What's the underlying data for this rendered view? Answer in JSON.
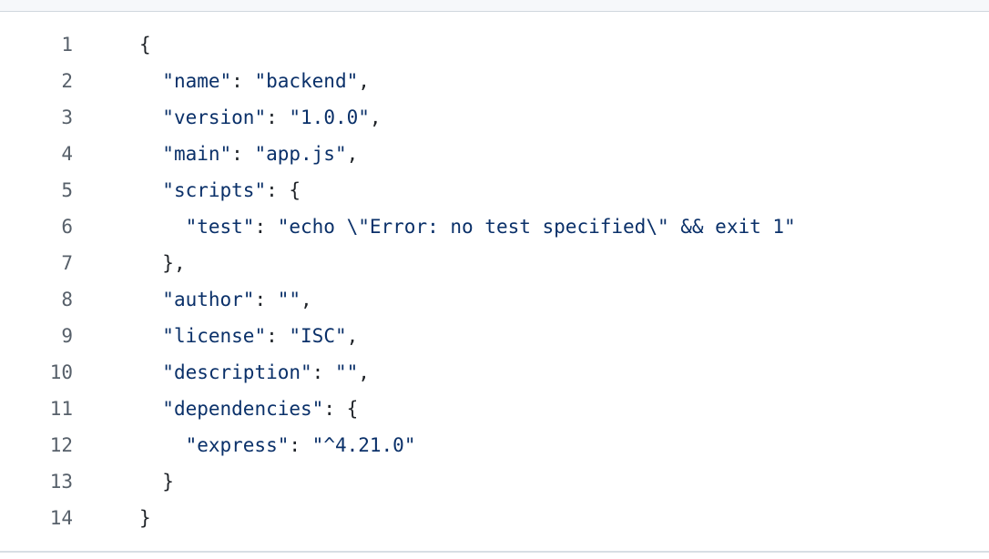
{
  "editor": {
    "language": "json",
    "lines": [
      {
        "number": "1",
        "indent": "",
        "tokens": [
          {
            "t": "p",
            "v": "{"
          }
        ]
      },
      {
        "number": "2",
        "indent": "  ",
        "tokens": [
          {
            "t": "k",
            "v": "\"name\""
          },
          {
            "t": "p",
            "v": ": "
          },
          {
            "t": "s",
            "v": "\"backend\""
          },
          {
            "t": "p",
            "v": ","
          }
        ]
      },
      {
        "number": "3",
        "indent": "  ",
        "tokens": [
          {
            "t": "k",
            "v": "\"version\""
          },
          {
            "t": "p",
            "v": ": "
          },
          {
            "t": "s",
            "v": "\"1.0.0\""
          },
          {
            "t": "p",
            "v": ","
          }
        ]
      },
      {
        "number": "4",
        "indent": "  ",
        "tokens": [
          {
            "t": "k",
            "v": "\"main\""
          },
          {
            "t": "p",
            "v": ": "
          },
          {
            "t": "s",
            "v": "\"app.js\""
          },
          {
            "t": "p",
            "v": ","
          }
        ]
      },
      {
        "number": "5",
        "indent": "  ",
        "tokens": [
          {
            "t": "k",
            "v": "\"scripts\""
          },
          {
            "t": "p",
            "v": ": {"
          }
        ]
      },
      {
        "number": "6",
        "indent": "    ",
        "tokens": [
          {
            "t": "k",
            "v": "\"test\""
          },
          {
            "t": "p",
            "v": ": "
          },
          {
            "t": "s",
            "v": "\"echo \\\"Error: no test specified\\\" && exit 1\""
          }
        ]
      },
      {
        "number": "7",
        "indent": "  ",
        "tokens": [
          {
            "t": "p",
            "v": "},"
          }
        ]
      },
      {
        "number": "8",
        "indent": "  ",
        "tokens": [
          {
            "t": "k",
            "v": "\"author\""
          },
          {
            "t": "p",
            "v": ": "
          },
          {
            "t": "s",
            "v": "\"\""
          },
          {
            "t": "p",
            "v": ","
          }
        ]
      },
      {
        "number": "9",
        "indent": "  ",
        "tokens": [
          {
            "t": "k",
            "v": "\"license\""
          },
          {
            "t": "p",
            "v": ": "
          },
          {
            "t": "s",
            "v": "\"ISC\""
          },
          {
            "t": "p",
            "v": ","
          }
        ]
      },
      {
        "number": "10",
        "indent": "  ",
        "tokens": [
          {
            "t": "k",
            "v": "\"description\""
          },
          {
            "t": "p",
            "v": ": "
          },
          {
            "t": "s",
            "v": "\"\""
          },
          {
            "t": "p",
            "v": ","
          }
        ]
      },
      {
        "number": "11",
        "indent": "  ",
        "tokens": [
          {
            "t": "k",
            "v": "\"dependencies\""
          },
          {
            "t": "p",
            "v": ": {"
          }
        ]
      },
      {
        "number": "12",
        "indent": "    ",
        "tokens": [
          {
            "t": "k",
            "v": "\"express\""
          },
          {
            "t": "p",
            "v": ": "
          },
          {
            "t": "s",
            "v": "\"^4.21.0\""
          }
        ]
      },
      {
        "number": "13",
        "indent": "  ",
        "tokens": [
          {
            "t": "p",
            "v": "}"
          }
        ]
      },
      {
        "number": "14",
        "indent": "",
        "tokens": [
          {
            "t": "p",
            "v": "}"
          }
        ]
      }
    ]
  },
  "colors": {
    "key": "#0a3069",
    "string": "#0a3069",
    "punctuation": "#1f2328",
    "line_number": "#57606a",
    "background": "#ffffff"
  }
}
